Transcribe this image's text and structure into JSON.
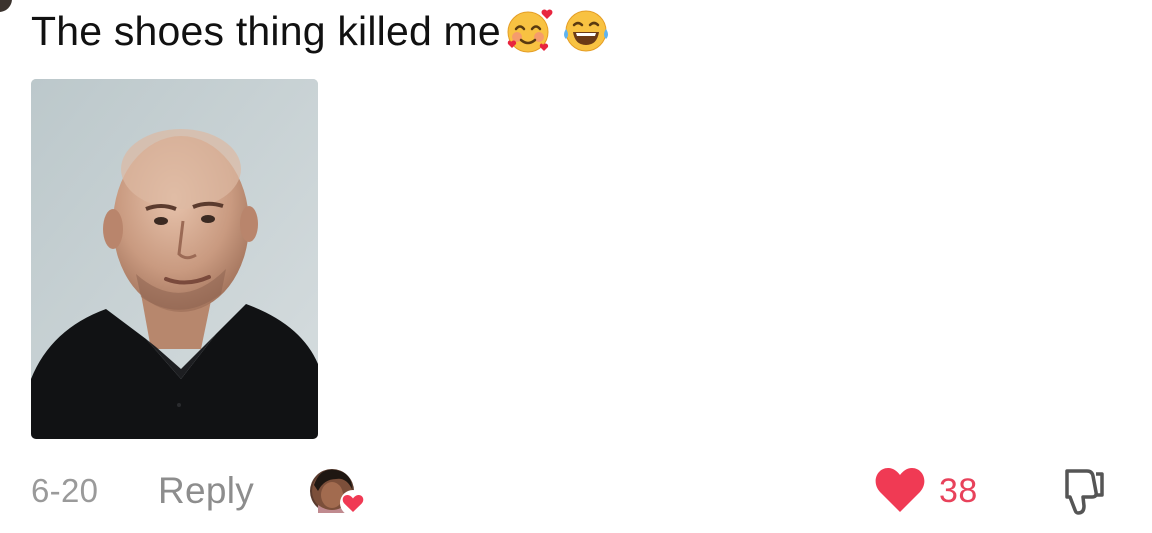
{
  "comment": {
    "text": "The shoes thing killed me",
    "emojis": [
      "smiling-face-with-hearts",
      "tears-of-joy"
    ],
    "date": "6-20",
    "reply_label": "Reply",
    "like_count": "38",
    "liked": true
  },
  "colors": {
    "like_red": "#f03a54",
    "muted_text": "#8d8d8d"
  },
  "icons": {
    "like": "heart-icon",
    "dislike": "thumbs-down-icon",
    "author_liked_badge": "heart-icon"
  }
}
